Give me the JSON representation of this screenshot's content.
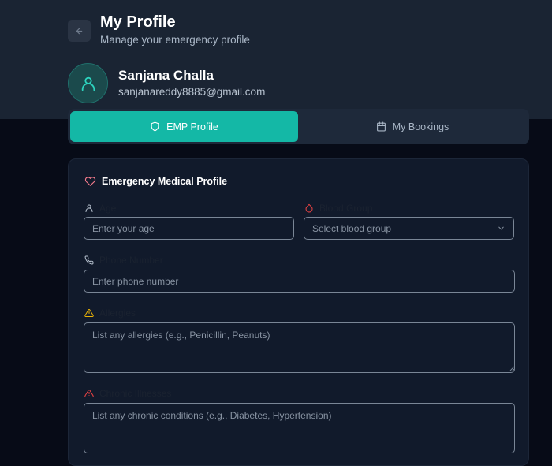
{
  "header": {
    "title": "My Profile",
    "subtitle": "Manage your emergency profile",
    "back_icon": "arrow-left-icon"
  },
  "user": {
    "name": "Sanjana Challa",
    "email": "sanjanareddy8885@gmail.com",
    "avatar_icon": "user-icon"
  },
  "tabs": [
    {
      "label": "EMP Profile",
      "icon": "shield-icon",
      "active": true
    },
    {
      "label": "My Bookings",
      "icon": "calendar-icon",
      "active": false
    }
  ],
  "card": {
    "title": "Emergency Medical Profile",
    "title_icon": "heart-icon",
    "fields": {
      "age": {
        "label": "Age",
        "placeholder": "Enter your age",
        "value": ""
      },
      "blood_group": {
        "label": "Blood Group",
        "placeholder": "Select blood group",
        "value": ""
      },
      "phone": {
        "label": "Phone Number",
        "placeholder": "Enter phone number",
        "value": ""
      },
      "allergies": {
        "label": "Allergies",
        "placeholder": "List any allergies (e.g., Penicillin, Peanuts)",
        "value": ""
      },
      "chronic": {
        "label": "Chronic Illnesses",
        "placeholder": "List any chronic conditions (e.g., Diabetes, Hypertension)",
        "value": ""
      }
    }
  },
  "colors": {
    "accent": "#14b8a6",
    "header_bg": "#1a2433",
    "page_bg": "#070b17",
    "card_bg": "#111a2b",
    "heart": "#f47b8c",
    "warning": "#eab308",
    "danger": "#ef4444"
  }
}
